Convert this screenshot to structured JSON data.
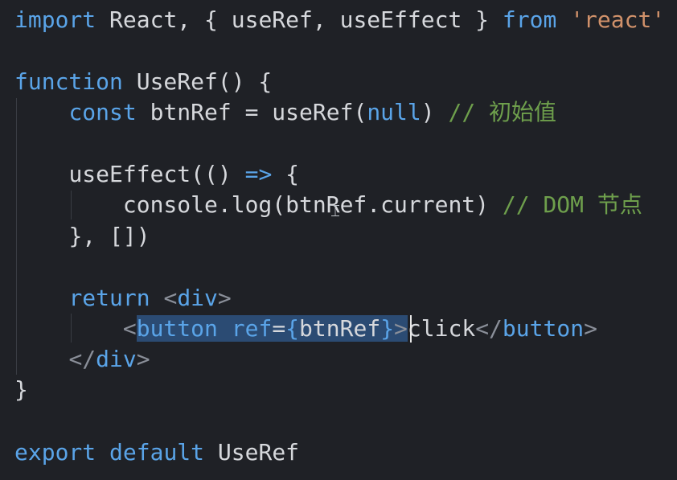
{
  "code": {
    "l1": {
      "a": "import",
      "b": " React, { useRef, useEffect } ",
      "c": "from",
      "d": " ",
      "e": "'react'"
    },
    "l2": {
      "a": "function",
      "b": " UseRef() {"
    },
    "l3": {
      "indent": "    ",
      "a": "const",
      "b": " btnRef = useRef(",
      "c": "null",
      "d": ") ",
      "e": "// 初始值"
    },
    "l4": {
      "indent": "    ",
      "a": "useEffect(() ",
      "b": "=>",
      "c": " {"
    },
    "l5": {
      "indent": "        ",
      "a": "console.log(btnRef.current) ",
      "b": "// DOM 节点"
    },
    "l6": {
      "indent": "    ",
      "a": "}, [])"
    },
    "l7": {
      "indent": "    ",
      "a": "return",
      "b": " ",
      "c": "<",
      "d": "div",
      "e": ">"
    },
    "l8": {
      "indent": "        ",
      "a": "<",
      "b": "button",
      "c": " ",
      "d": "ref",
      "e": "=",
      "f": "{",
      "g": "btnRef",
      "h": "}",
      "i": ">",
      "j": "click",
      "k": "</",
      "l": "button",
      "m": ">"
    },
    "l9": {
      "indent": "    ",
      "a": "</",
      "b": "div",
      "c": ">"
    },
    "l10": {
      "a": "}"
    },
    "l11": {
      "a": "export",
      "b": " ",
      "c": "default",
      "d": " UseRef"
    }
  },
  "colors": {
    "background": "#1f2126",
    "keyword": "#5aa4e8",
    "string": "#d0916a",
    "comment": "#6e9f4c",
    "selection": "#2b4b73",
    "text": "#d6d8dc"
  },
  "icons": {
    "mouse_pointer": "text-ibeam-cursor"
  }
}
